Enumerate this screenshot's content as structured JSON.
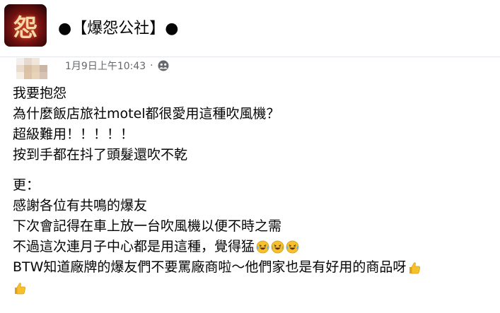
{
  "group": {
    "name": "●【爆怨公社】●",
    "avatar_alt_glyph": "怨"
  },
  "post": {
    "timestamp": "1月9日上午10:43",
    "separator": "·",
    "privacy_icon": "friends-icon",
    "paragraph1": [
      "我要抱怨",
      "為什麼飯店旅社motel都很愛用這種吹風機？",
      "超級難用！！！！！",
      "按到手都在抖了頭髮還吹不乾"
    ],
    "paragraph2": [
      "更：",
      "感謝各位有共鳴的爆友",
      "下次會記得在車上放一台吹風機以便不時之需",
      "不過這次連月子中心都是用這種，覺得猛",
      "BTW知道廠牌的爆友們不要罵廠商啦～他們家也是有好用的商品呀"
    ],
    "emoji_laugh": "rolling-on-floor-laughing-icon",
    "emoji_thumb": "thumbs-up-icon"
  },
  "colors": {
    "meta_text": "#65676b",
    "body_text": "#050505",
    "divider": "#e4e6eb"
  }
}
